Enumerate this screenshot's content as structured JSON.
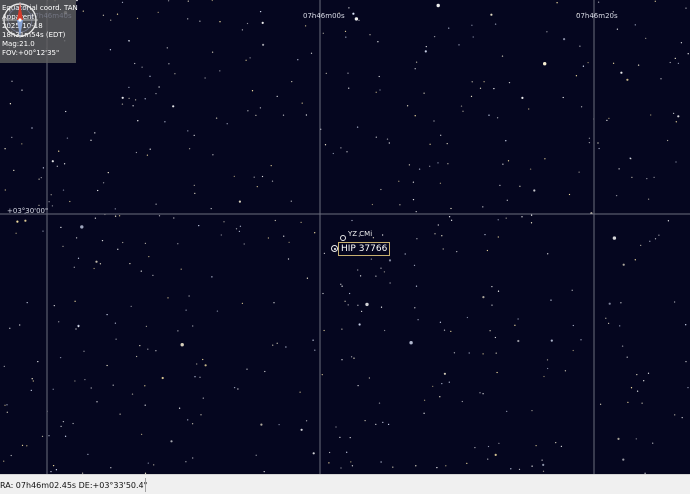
{
  "info_panel": {
    "lines": [
      "Equatorial coord. TAN",
      "Apparent",
      "2025-10-18",
      "18h31m54s (EDT)",
      "Mag:21.0",
      "FOV:+00°12'35\""
    ],
    "ghost_label": "07h46m40s"
  },
  "grid": {
    "ra_labels": [
      "07h46m00s",
      "07h46m20s"
    ],
    "dec_labels": [
      "+03°30'00\""
    ]
  },
  "objects": {
    "variable_star_name": "YZ CMi",
    "selected_star_name": "HIP 37766"
  },
  "compass": {
    "north_color": "#d63a2a",
    "south_color": "#8aa6d8"
  },
  "status_bar": {
    "coordinates": "RA: 07h46m02.45s DE:+03°33'50.4\""
  },
  "colors": {
    "sky_background": "#05061f",
    "grid": "#6a6d7e",
    "selection_border": "#c8b070"
  }
}
